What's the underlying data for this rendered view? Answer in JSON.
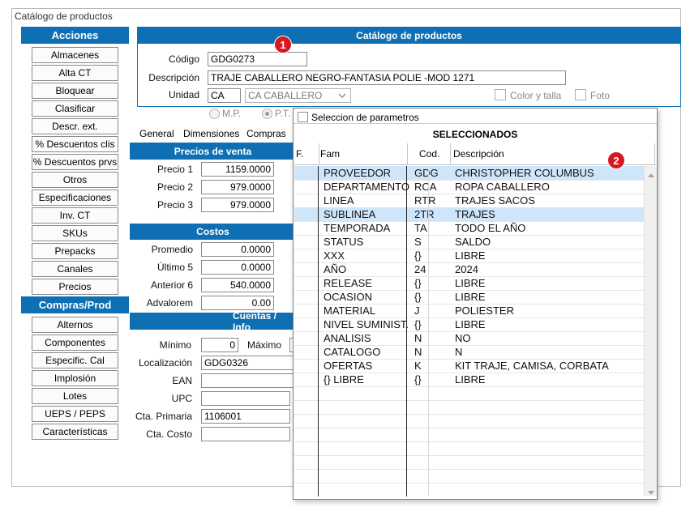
{
  "window": {
    "title": "Catálogo de productos"
  },
  "acciones": {
    "header": "Acciones",
    "buttons": [
      "Almacenes",
      "Alta CT",
      "Bloquear",
      "Clasificar",
      "Descr. ext.",
      "% Descuentos clis",
      "% Descuentos prvs",
      "Otros",
      "Especificaciones",
      "Inv. CT",
      "SKUs",
      "Prepacks",
      "Canales",
      "Precios"
    ]
  },
  "compras": {
    "header": "Compras/Prod",
    "buttons": [
      "Alternos",
      "Componentes",
      "Especific. Cal",
      "Implosión",
      "Lotes",
      "UEPS / PEPS",
      "Características"
    ]
  },
  "form": {
    "title": "Catálogo de productos",
    "codigo_label": "Código",
    "codigo": "GDG0273",
    "descripcion_label": "Descripción",
    "descripcion": "TRAJE  CABALLERO NEGRO-FANTASIA POLIE -MOD 1271",
    "unidad_label": "Unidad",
    "unidad_code": "CA",
    "unidad_select": "CA  CABALLERO",
    "color_talla": "Color y talla",
    "foto": "Foto",
    "radio_mp": "M.P.",
    "radio_pt": "P.T."
  },
  "badges": {
    "one": "1",
    "two": "2"
  },
  "tabs": [
    "General",
    "Dimensiones",
    "Compras"
  ],
  "precios": {
    "header": "Precios de venta",
    "rows": [
      {
        "label": "Precio 1",
        "value": "1159.0000"
      },
      {
        "label": "Precio 2",
        "value": "979.0000"
      },
      {
        "label": "Precio 3",
        "value": "979.0000"
      }
    ]
  },
  "costos": {
    "header": "Costos",
    "rows": [
      {
        "label": "Promedio",
        "value": "0.0000"
      },
      {
        "label": "Último 5",
        "value": "0.0000"
      },
      {
        "label": "Anterior 6",
        "value": "540.0000"
      },
      {
        "label": "Advalorem",
        "value": "0.00"
      }
    ]
  },
  "cuentas": {
    "header": "Cuentas / Info",
    "minimo_label": "Mínimo",
    "minimo": "0",
    "maximo_label": "Máximo",
    "localizacion_label": "Localización",
    "localizacion": "GDG0326",
    "ean_label": "EAN",
    "ean": "",
    "upc_label": "UPC",
    "upc": "",
    "cta_primaria_label": "Cta. Primaria",
    "cta_primaria": "1106001",
    "cta_costo_label": "Cta. Costo",
    "cta_costo": ""
  },
  "popup": {
    "checkbox_label": "Seleccion de parametros",
    "title": "SELECCIONADOS",
    "columns": {
      "f": "F.",
      "fam": "Fam",
      "cod": "Cod.",
      "desc": "Descripción"
    },
    "rows": [
      {
        "fam": "PROVEEDOR",
        "cod": "GDG",
        "desc": "CHRISTOPHER COLUMBUS",
        "selected": true
      },
      {
        "fam": "DEPARTAMENTO",
        "cod": "RCA",
        "desc": "ROPA CABALLERO",
        "selected": false
      },
      {
        "fam": "LINEA",
        "cod": "RTR",
        "desc": "TRAJES SACOS",
        "selected": false
      },
      {
        "fam": "SUBLINEA",
        "cod": "2TR",
        "desc": "TRAJES",
        "selected": true
      },
      {
        "fam": "TEMPORADA",
        "cod": "TA",
        "desc": "TODO EL AÑO",
        "selected": false
      },
      {
        "fam": "STATUS",
        "cod": "S",
        "desc": "SALDO",
        "selected": false
      },
      {
        "fam": "XXX",
        "cod": "{}",
        "desc": "LIBRE",
        "selected": false
      },
      {
        "fam": "AÑO",
        "cod": "24",
        "desc": "2024",
        "selected": false
      },
      {
        "fam": "RELEASE",
        "cod": "{}",
        "desc": "LIBRE",
        "selected": false
      },
      {
        "fam": "OCASION",
        "cod": "{}",
        "desc": "LIBRE",
        "selected": false
      },
      {
        "fam": "MATERIAL",
        "cod": "J",
        "desc": "POLIESTER",
        "selected": false
      },
      {
        "fam": "NIVEL SUMINIST.",
        "cod": "{}",
        "desc": "LIBRE",
        "selected": false
      },
      {
        "fam": "ANALISIS",
        "cod": "N",
        "desc": "NO",
        "selected": false
      },
      {
        "fam": "CATALOGO",
        "cod": "N",
        "desc": "N",
        "selected": false
      },
      {
        "fam": "OFERTAS",
        "cod": "K",
        "desc": "KIT TRAJE, CAMISA, CORBATA",
        "selected": false
      },
      {
        "fam": "{}  LIBRE",
        "cod": "{}",
        "desc": "LIBRE",
        "selected": false
      }
    ]
  }
}
